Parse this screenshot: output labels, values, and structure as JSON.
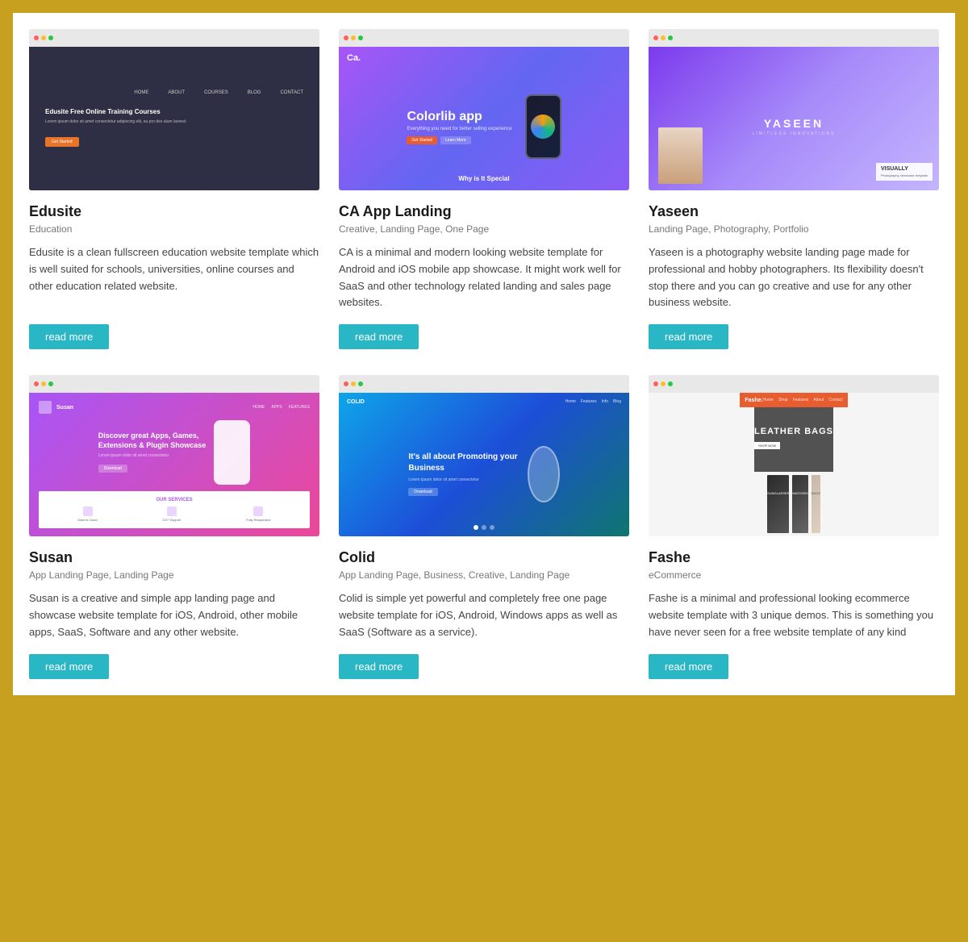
{
  "cards": [
    {
      "id": "edusite",
      "title": "Edusite",
      "tags": "Education",
      "desc": "Edusite is a clean fullscreen education website template which is well suited for schools, universities, online courses and other education related website.",
      "btn": "read more"
    },
    {
      "id": "ca-app",
      "title": "CA App Landing",
      "tags": "Creative, Landing Page, One Page",
      "desc": "CA is a minimal and modern looking website template for Android and iOS mobile app showcase. It might work well for SaaS and other technology related landing and sales page websites.",
      "btn": "read more"
    },
    {
      "id": "yaseen",
      "title": "Yaseen",
      "tags": "Landing Page, Photography, Portfolio",
      "desc": "Yaseen is a photography website landing page made for professional and hobby photographers. Its flexibility doesn't stop there and you can go creative and use for any other business website.",
      "btn": "read more"
    },
    {
      "id": "susan",
      "title": "Susan",
      "tags": "App Landing Page, Landing Page",
      "desc": "Susan is a creative and simple app landing page and showcase website template for iOS, Android, other mobile apps, SaaS, Software and any other website.",
      "btn": "read more"
    },
    {
      "id": "colid",
      "title": "Colid",
      "tags": "App Landing Page, Business, Creative, Landing Page",
      "desc": "Colid is simple yet powerful and completely free one page website template for iOS, Android, Windows apps as well as SaaS (Software as a service).",
      "btn": "read more"
    },
    {
      "id": "fashe",
      "title": "Fashe",
      "tags": "eCommerce",
      "desc": "Fashe is a minimal and professional looking ecommerce website template with 3 unique demos. This is something you have never seen for a free website template of any kind",
      "btn": "read more"
    }
  ]
}
